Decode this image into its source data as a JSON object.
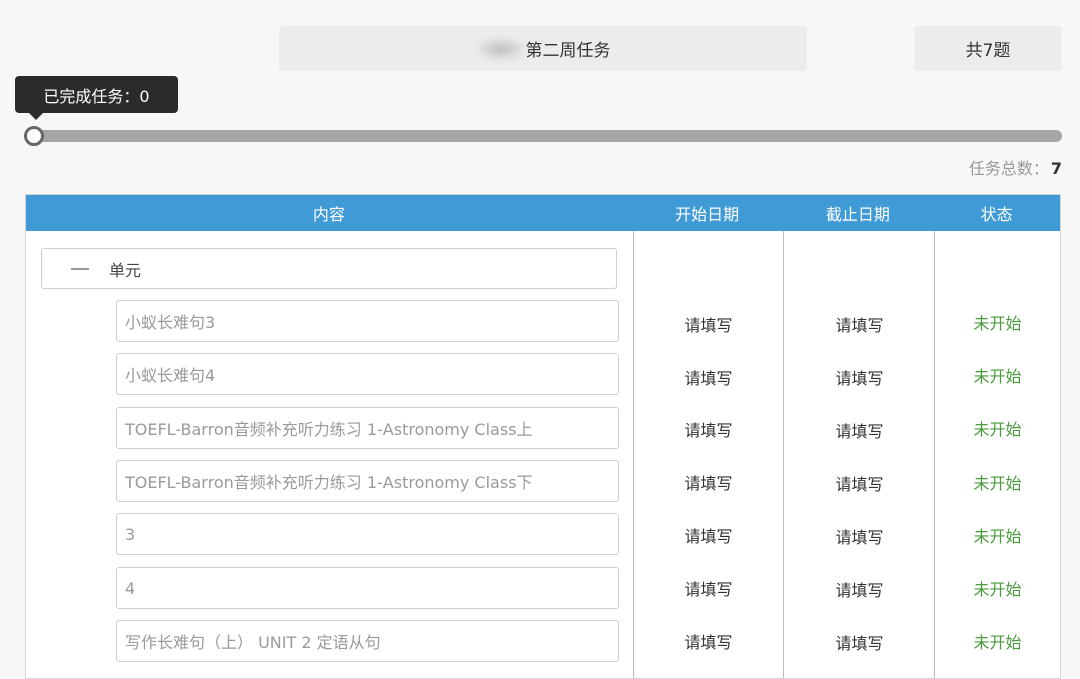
{
  "header": {
    "title": "第二周任务",
    "question_count": "共7题"
  },
  "progress": {
    "tooltip": "已完成任务：0",
    "completed": 0,
    "total_label": "任务总数：",
    "total": "7"
  },
  "table": {
    "columns": [
      "内容",
      "开始日期",
      "截止日期",
      "状态"
    ],
    "group_label": "单元",
    "rows": [
      {
        "name": "小蚁长难句3",
        "start": "请填写",
        "end": "请填写",
        "status": "未开始"
      },
      {
        "name": "小蚁长难句4",
        "start": "请填写",
        "end": "请填写",
        "status": "未开始"
      },
      {
        "name": "TOEFL-Barron音频补充听力练习 1-Astronomy Class上",
        "start": "请填写",
        "end": "请填写",
        "status": "未开始"
      },
      {
        "name": "TOEFL-Barron音频补充听力练习 1-Astronomy Class下",
        "start": "请填写",
        "end": "请填写",
        "status": "未开始"
      },
      {
        "name": "3",
        "start": "请填写",
        "end": "请填写",
        "status": "未开始"
      },
      {
        "name": "4",
        "start": "请填写",
        "end": "请填写",
        "status": "未开始"
      },
      {
        "name": "写作长难句（上） UNIT 2 定语从句",
        "start": "请填写",
        "end": "请填写",
        "status": "未开始"
      }
    ]
  },
  "colors": {
    "header_blue": "#3f9ad6",
    "status_green": "#4a9a3c"
  }
}
